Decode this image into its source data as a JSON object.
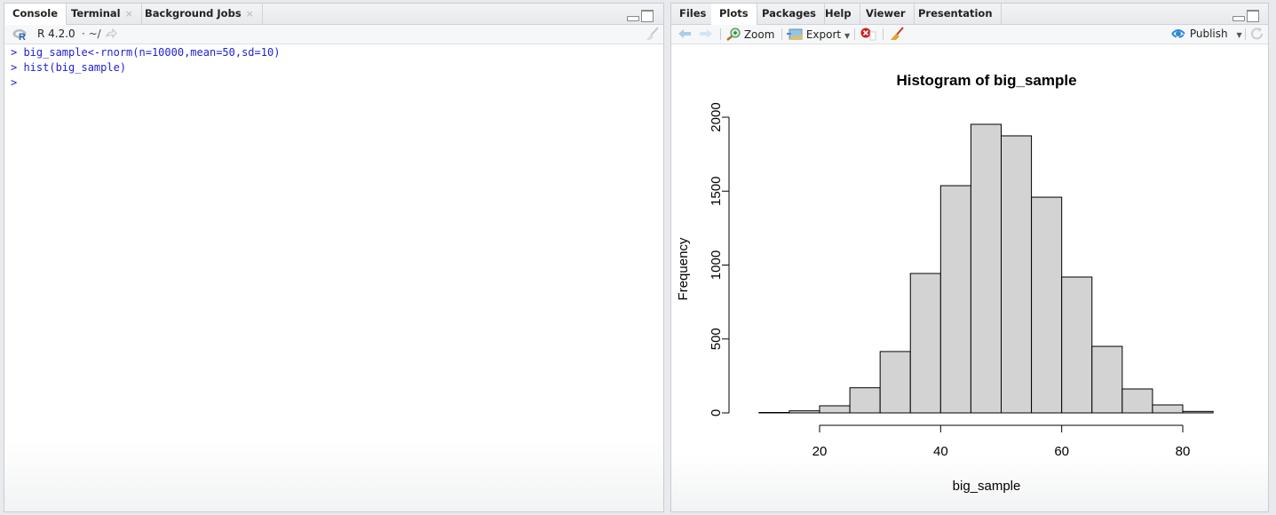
{
  "left_pane": {
    "tabs": [
      {
        "label": "Console",
        "active": true,
        "closable": false
      },
      {
        "label": "Terminal",
        "active": false,
        "closable": true
      },
      {
        "label": "Background Jobs",
        "active": false,
        "closable": true
      }
    ],
    "close_glyph": "×",
    "r_version": "R 4.2.0",
    "working_dir": "· ~/",
    "console_lines": [
      "> big_sample<-rnorm(n=10000,mean=50,sd=10)",
      "> hist(big_sample)",
      ">"
    ]
  },
  "right_pane": {
    "tabs": [
      {
        "label": "Files",
        "active": false
      },
      {
        "label": "Plots",
        "active": true
      },
      {
        "label": "Packages",
        "active": false
      },
      {
        "label": "Help",
        "active": false
      },
      {
        "label": "Viewer",
        "active": false
      },
      {
        "label": "Presentation",
        "active": false
      }
    ],
    "toolbar": {
      "zoom_label": "Zoom",
      "export_label": "Export",
      "publish_label": "Publish"
    }
  },
  "colors": {
    "console_text": "#1f1fd6",
    "bar_fill": "#d3d3d3",
    "bar_stroke": "#000000"
  },
  "chart_data": {
    "type": "bar",
    "title": "Histogram of big_sample",
    "xlabel": "big_sample",
    "ylabel": "Frequency",
    "bin_edges": [
      10,
      15,
      20,
      25,
      30,
      35,
      40,
      45,
      50,
      55,
      60,
      65,
      70,
      75,
      80,
      85
    ],
    "values": [
      3,
      14,
      48,
      170,
      415,
      943,
      1537,
      1952,
      1874,
      1459,
      919,
      450,
      162,
      54,
      10
    ],
    "xlim": [
      10,
      85
    ],
    "ylim": [
      0,
      2000
    ],
    "x_ticks": [
      20,
      40,
      60,
      80
    ],
    "y_ticks": [
      0,
      500,
      1000,
      1500,
      2000
    ],
    "grid": false,
    "legend": "none"
  }
}
